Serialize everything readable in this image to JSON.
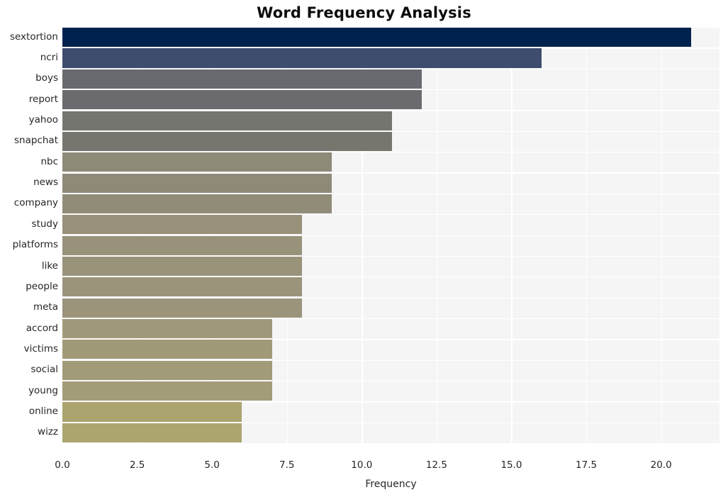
{
  "chart_data": {
    "type": "bar",
    "orientation": "horizontal",
    "title": "Word Frequency Analysis",
    "xlabel": "Frequency",
    "ylabel": "",
    "xlim": [
      0,
      21.95
    ],
    "xticks": [
      "0.0",
      "2.5",
      "5.0",
      "7.5",
      "10.0",
      "12.5",
      "15.0",
      "17.5",
      "20.0"
    ],
    "xtick_values": [
      0,
      2.5,
      5,
      7.5,
      10,
      12.5,
      15,
      17.5,
      20
    ],
    "grid": true,
    "legend": null,
    "categories": [
      "sextortion",
      "ncri",
      "boys",
      "report",
      "yahoo",
      "snapchat",
      "nbc",
      "news",
      "company",
      "study",
      "platforms",
      "like",
      "people",
      "meta",
      "accord",
      "victims",
      "social",
      "young",
      "online",
      "wizz"
    ],
    "values": [
      21,
      16,
      12,
      12,
      11,
      11,
      9,
      9,
      9,
      8,
      8,
      8,
      8,
      8,
      7,
      7,
      7,
      7,
      6,
      6
    ],
    "bar_colors": [
      "#00224e",
      "#3e4c6d",
      "#696a6f",
      "#6b6b6f",
      "#757570",
      "#76766f",
      "#8e8a78",
      "#8f8a78",
      "#918c78",
      "#97917a",
      "#98927a",
      "#99937a",
      "#9a947b",
      "#9b947b",
      "#a09979",
      "#a19a79",
      "#a29b79",
      "#a39c79",
      "#aba46e",
      "#aca56e"
    ],
    "plot_background": "#f5f5f6",
    "grid_color": "#ffffff",
    "text_color": "#262626"
  }
}
